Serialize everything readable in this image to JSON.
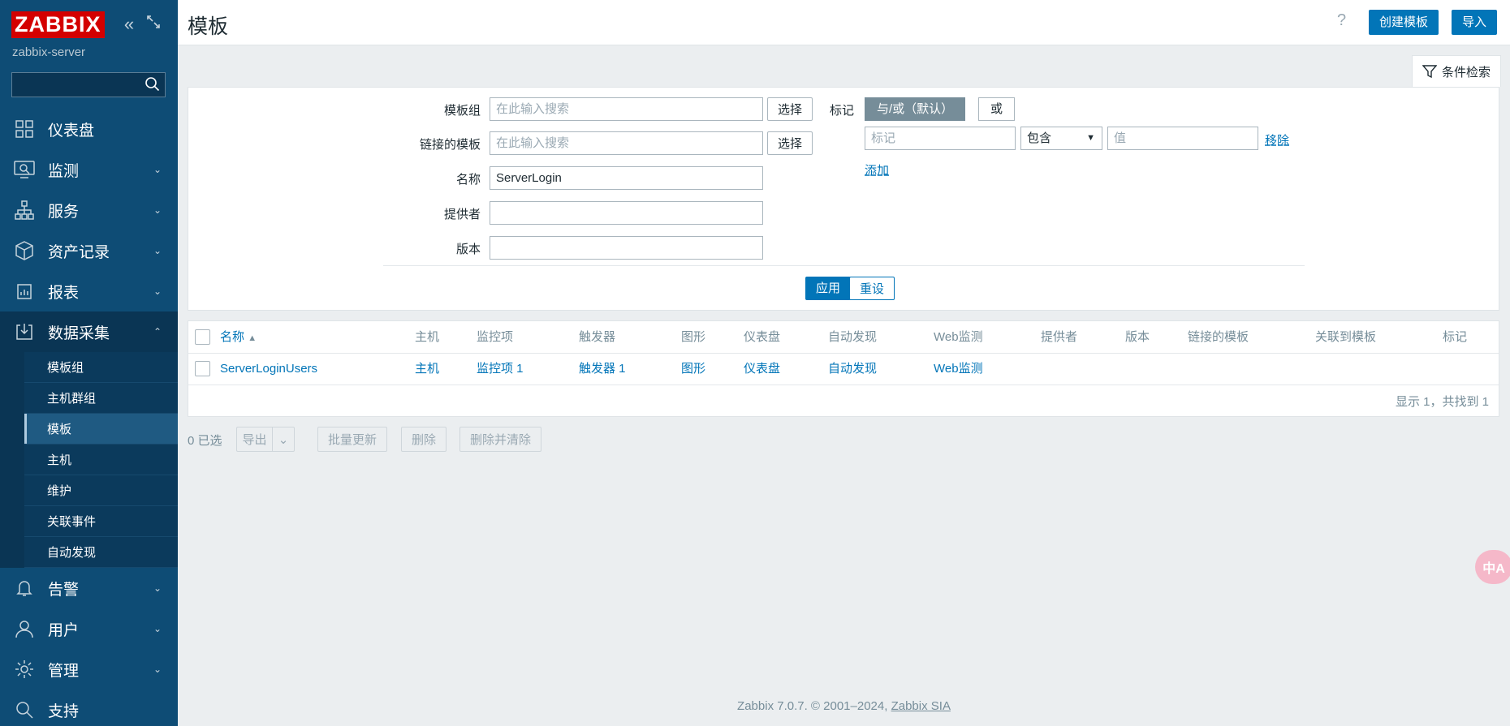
{
  "sidebar": {
    "logo": "ZABBIX",
    "server_name": "zabbix-server",
    "search_placeholder": "",
    "menu": [
      {
        "label": "仪表盘",
        "icon": "dashboard-icon"
      },
      {
        "label": "监测",
        "icon": "monitoring-icon"
      },
      {
        "label": "服务",
        "icon": "services-icon"
      },
      {
        "label": "资产记录",
        "icon": "inventory-icon"
      },
      {
        "label": "报表",
        "icon": "reports-icon"
      },
      {
        "label": "数据采集",
        "icon": "data-collection-icon"
      },
      {
        "label": "告警",
        "icon": "alerts-icon"
      },
      {
        "label": "用户",
        "icon": "users-icon"
      },
      {
        "label": "管理",
        "icon": "administration-icon"
      },
      {
        "label": "支持",
        "icon": "support-icon"
      }
    ],
    "submenu": [
      "模板组",
      "主机群组",
      "模板",
      "主机",
      "维护",
      "关联事件",
      "自动发现"
    ],
    "selected_submenu": "模板"
  },
  "header": {
    "title": "模板",
    "help": "?",
    "create_button": "创建模板",
    "import_button": "导入"
  },
  "filter": {
    "tab_label": "条件检索",
    "template_group_label": "模板组",
    "template_group_placeholder": "在此输入搜索",
    "linked_templates_label": "链接的模板",
    "linked_templates_placeholder": "在此输入搜索",
    "select_label": "选择",
    "name_label": "名称",
    "name_value": "ServerLogin",
    "vendor_label": "提供者",
    "vendor_value": "",
    "version_label": "版本",
    "version_value": "",
    "tags_label": "标记",
    "tags_and_or": "与/或（默认）",
    "tags_or": "或",
    "tag_placeholder": "标记",
    "tag_operator": "包含",
    "value_placeholder": "值",
    "remove_label": "移除",
    "add_label": "添加",
    "apply_button": "应用",
    "reset_button": "重设"
  },
  "table": {
    "columns": [
      "名称",
      "主机",
      "监控项",
      "触发器",
      "图形",
      "仪表盘",
      "自动发现",
      "Web监测",
      "提供者",
      "版本",
      "链接的模板",
      "关联到模板",
      "标记"
    ],
    "sort_indicator": "▲",
    "rows": [
      {
        "name": "ServerLoginUsers",
        "hosts": "主机",
        "items": "监控项 1",
        "triggers": "触发器 1",
        "graphs": "图形",
        "dashboards": "仪表盘",
        "discovery": "自动发现",
        "web": "Web监测",
        "vendor": "",
        "version": "",
        "linked_templates": "",
        "linked_to": "",
        "tags": ""
      }
    ],
    "paging": "显示 1，共找到 1"
  },
  "mass_actions": {
    "selected_count": "0 已选",
    "export": "导出",
    "mass_update": "批量更新",
    "delete": "删除",
    "delete_and_clear": "删除并清除"
  },
  "footer": {
    "text": "Zabbix 7.0.7. © 2001–2024, ",
    "link": "Zabbix SIA"
  },
  "translate_bubble": "中A"
}
